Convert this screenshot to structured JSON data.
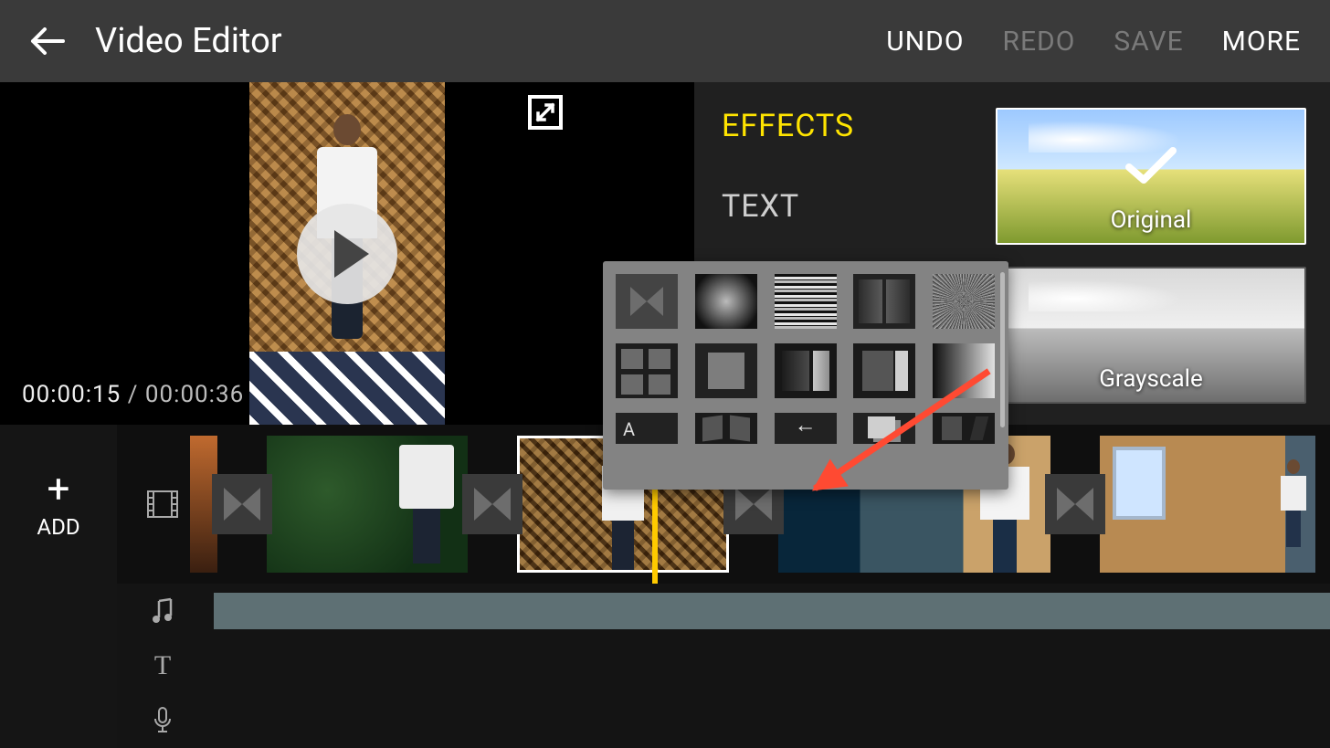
{
  "header": {
    "title": "Video Editor",
    "actions": {
      "undo": "UNDO",
      "redo": "REDO",
      "save": "SAVE",
      "more": "MORE"
    }
  },
  "preview": {
    "current_time": "00:00:15",
    "total_time": "00:00:36",
    "separator": "/"
  },
  "side_panel": {
    "tabs": {
      "effects": "EFFECTS",
      "text": "TEXT"
    },
    "effects": [
      {
        "id": "original",
        "label": "Original",
        "selected": true
      },
      {
        "id": "grayscale",
        "label": "Grayscale",
        "selected": false
      }
    ]
  },
  "timeline": {
    "add_label": "ADD",
    "track_icons": {
      "video": "film-icon",
      "audio": "music-icon",
      "text": "text-icon",
      "voice": "mic-icon"
    }
  },
  "transitions_popup": {
    "items": [
      "bowtie",
      "radial-fade",
      "horizontal-lines",
      "fold",
      "noise",
      "grid-4",
      "square-in",
      "cube",
      "box-3d",
      "gradient-wipe",
      "text-a",
      "hinge",
      "arrow-left",
      "stack",
      "morph"
    ]
  }
}
